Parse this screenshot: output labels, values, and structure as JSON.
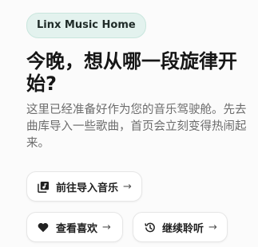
{
  "badge": {
    "label": "Linx Music Home"
  },
  "hero": {
    "headline": "今晚，想从哪一段旋律开始?",
    "description": "这里已经准备好作为您的音乐驾驶舱。先去曲库导入一些歌曲，首页会立刻变得热闹起来。"
  },
  "actions": {
    "import": {
      "label": "前往导入音乐",
      "icon": "music-library-icon",
      "arrow": "→"
    },
    "likes": {
      "label": "查看喜欢",
      "icon": "heart-icon",
      "arrow": "→"
    },
    "continue": {
      "label": "继续聆听",
      "icon": "history-icon",
      "arrow": "→"
    }
  }
}
